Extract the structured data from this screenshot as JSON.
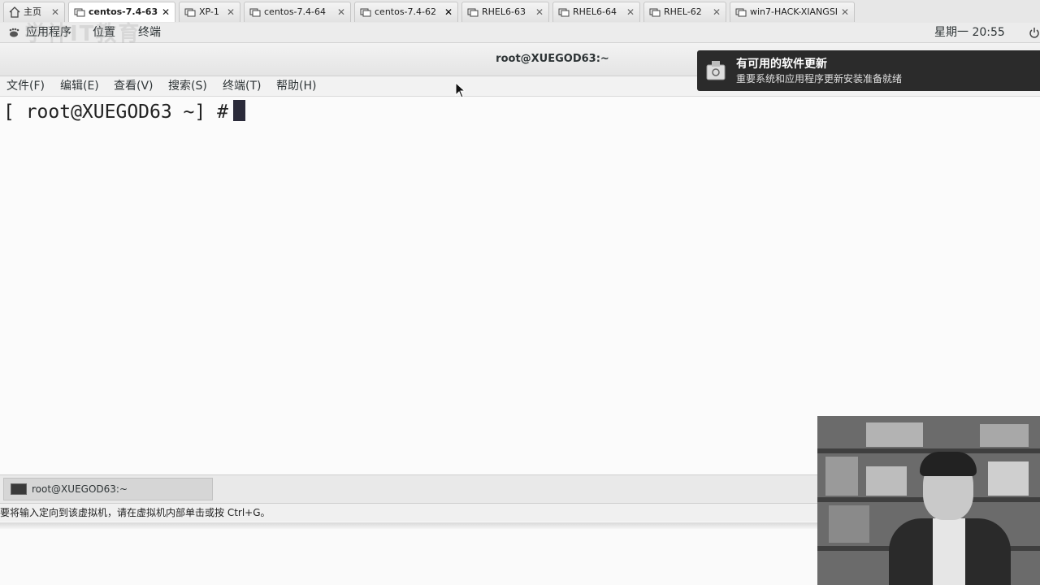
{
  "vm_tabs": [
    {
      "label": "主页",
      "active": false
    },
    {
      "label": "centos-7.4-63",
      "active": true
    },
    {
      "label": "XP-1",
      "active": false
    },
    {
      "label": "centos-7.4-64",
      "active": false
    },
    {
      "label": "centos-7.4-62",
      "active": false
    },
    {
      "label": "RHEL6-63",
      "active": false
    },
    {
      "label": "RHEL6-64",
      "active": false
    },
    {
      "label": "RHEL-62",
      "active": false
    },
    {
      "label": "win7-HACK-XIANGSI",
      "active": false
    }
  ],
  "panel": {
    "applications": "应用程序",
    "places": "位置",
    "terminal": "终端",
    "clock": "星期一 20:55",
    "watermark": "学神IT教育"
  },
  "terminal": {
    "title": "root@XUEGOD63:~",
    "menu": [
      "文件(F)",
      "编辑(E)",
      "查看(V)",
      "搜索(S)",
      "终端(T)",
      "帮助(H)"
    ],
    "prompt": "[ root@XUEGOD63 ~] # "
  },
  "notification": {
    "title": "有可用的软件更新",
    "body": "重要系统和应用程序更新安装准备就绪"
  },
  "taskbar": {
    "window_label": "root@XUEGOD63:~"
  },
  "statusbar": {
    "hint": "要将输入定向到该虚拟机，请在虚拟机内部单击或按 Ctrl+G。"
  },
  "colors": {
    "terminal_bg": "#fbfbfb",
    "notification_bg": "#2b2b2b",
    "cursor": "#2b2b3a"
  }
}
